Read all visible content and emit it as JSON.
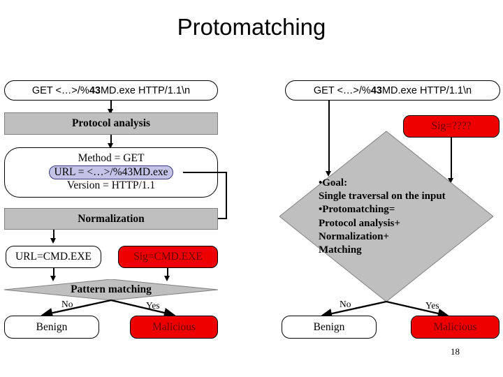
{
  "slide": {
    "title": "Protomatching",
    "number": "18",
    "colors": {
      "process_gray": "#BFBFBF",
      "alert_red": "#EE0000",
      "alert_red_text": "#6B0000",
      "highlight_lavender": "#C3C3E8",
      "line_black": "#000000",
      "background": "#FFFFFF"
    }
  },
  "left_flow": {
    "packet": {
      "prefix": "GET  <…>/%",
      "bold": "43",
      "suffix": "MD.exe  HTTP/1.1\\n"
    },
    "protocol_analysis": "Protocol analysis",
    "parsed": {
      "method": "Method = GET",
      "url_highlight": "URL = <…>/%43MD.exe",
      "version": "Version = HTTP/1.1"
    },
    "normalization": "Normalization",
    "normalized_url": "URL=CMD.EXE",
    "signature": "Sig=CMD.EXE",
    "pattern_matching": "Pattern matching",
    "branch_no": "No",
    "branch_yes": "Yes",
    "verdict_benign": "Benign",
    "verdict_malicious": "Malicious"
  },
  "right_flow": {
    "packet": {
      "prefix": "GET  <…>/%",
      "bold": "43",
      "suffix": "MD.exe  HTTP/1.1\\n"
    },
    "signature": "Sig=????",
    "summary": "•Goal:\nSingle traversal on the input\n•Protomatching=\nProtocol analysis+\nNormalization+\nMatching",
    "branch_no": "No",
    "branch_yes": "Yes",
    "verdict_benign": "Benign",
    "verdict_malicious": "Malicious"
  }
}
